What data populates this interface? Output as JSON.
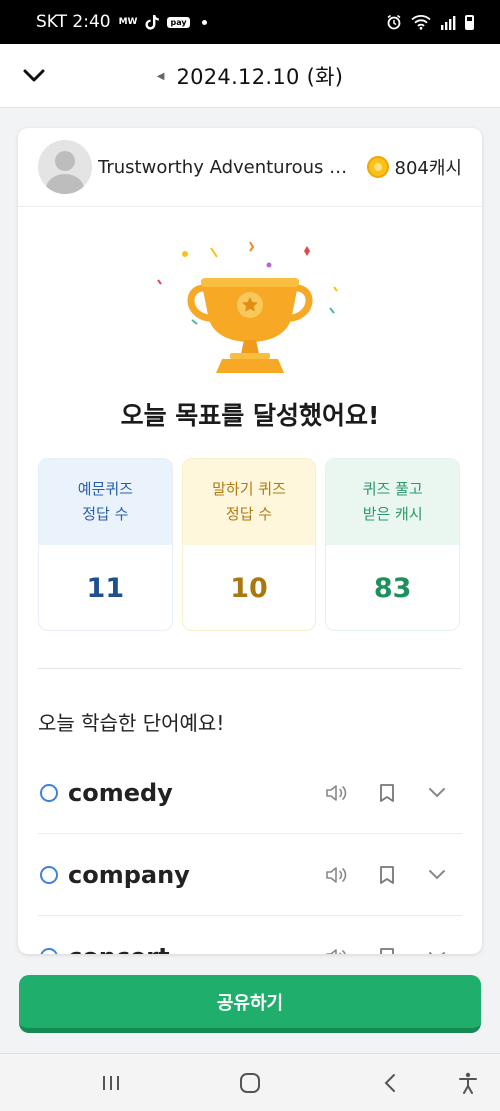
{
  "status_bar": {
    "carrier_time": "SKT 2:40",
    "mini_label": "MW",
    "pay_label": "pay"
  },
  "header": {
    "date": "2024.12.10 (화)"
  },
  "profile": {
    "username": "Trustworthy Adventurous Explorer",
    "cash": "804캐시"
  },
  "headline": "오늘 목표를 달성했어요!",
  "stats": [
    {
      "label_line1": "예문퀴즈",
      "label_line2": "정답 수",
      "value": "11",
      "color": "#1e4f8f"
    },
    {
      "label_line1": "말하기 퀴즈",
      "label_line2": "정답 수",
      "value": "10",
      "color": "#a9780f"
    },
    {
      "label_line1": "퀴즈 풀고",
      "label_line2": "받은 캐시",
      "value": "83",
      "color": "#1f8f5b"
    }
  ],
  "words_section": {
    "title": "오늘 학습한 단어예요!",
    "words": [
      "comedy",
      "company",
      "concert"
    ]
  },
  "share_button": "공유하기",
  "colors": {
    "accent_green": "#1fae6b",
    "word_circle": "#3f83d8",
    "trophy": "#f7a824"
  }
}
